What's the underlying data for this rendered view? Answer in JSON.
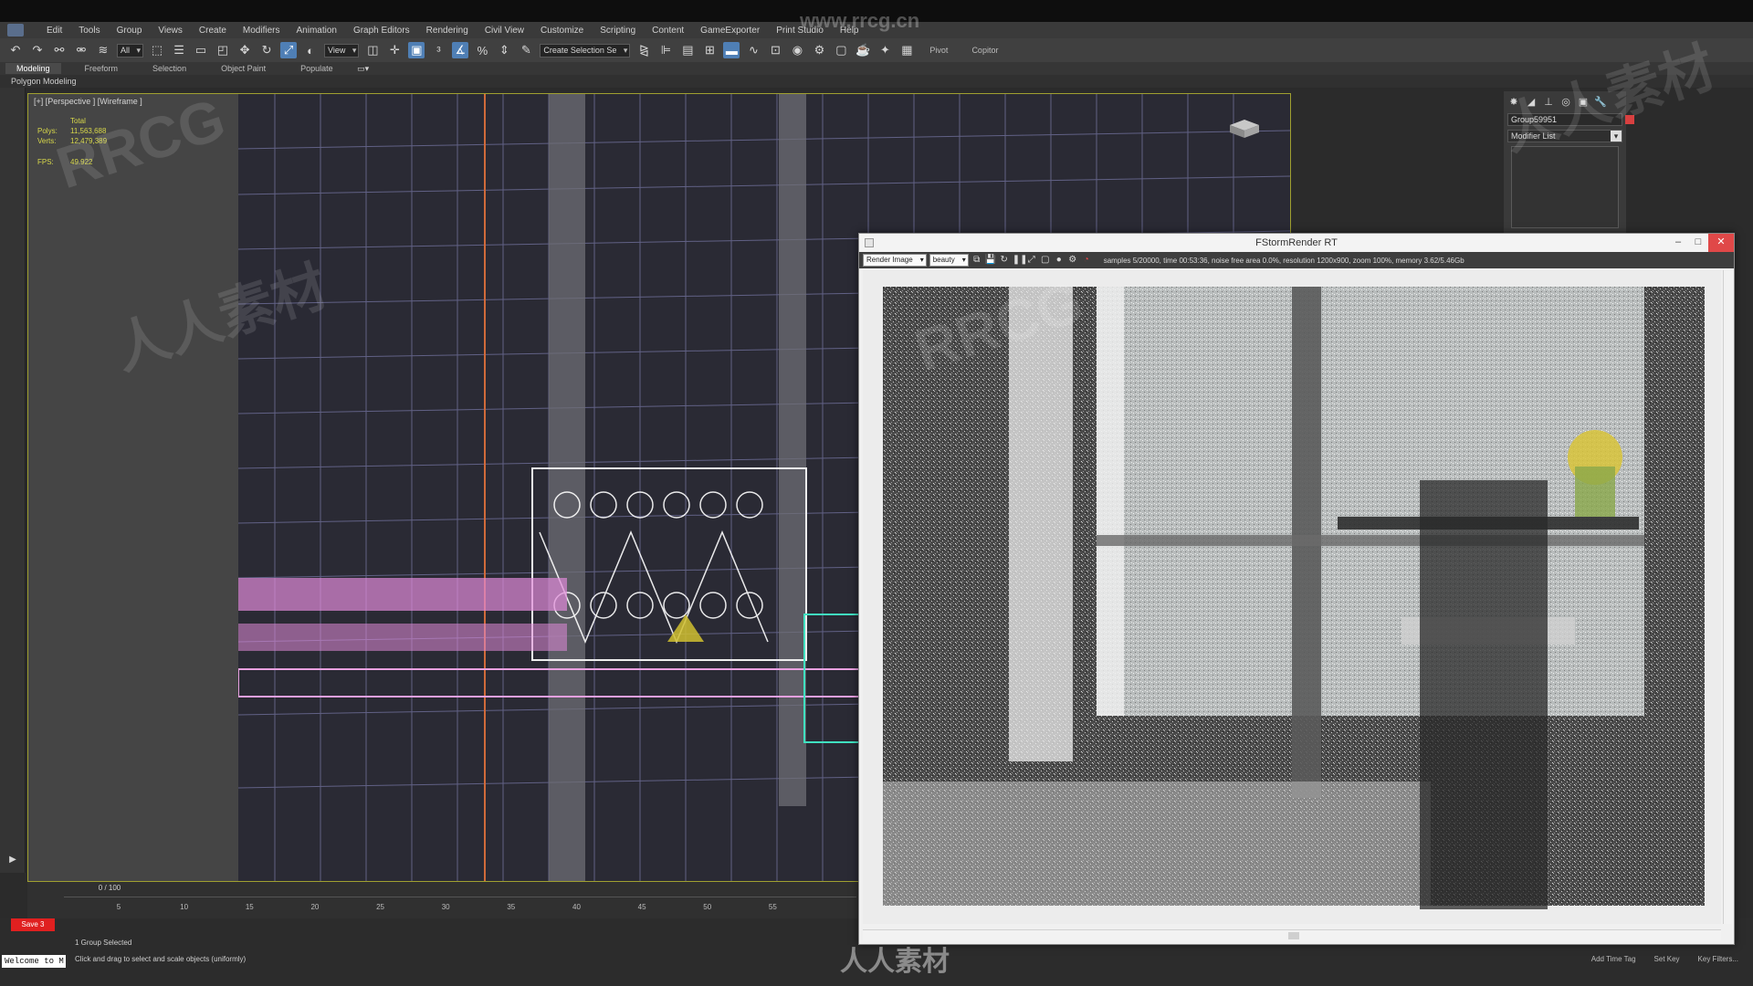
{
  "app": {
    "menu": [
      "Edit",
      "Tools",
      "Group",
      "Views",
      "Create",
      "Modifiers",
      "Animation",
      "Graph Editors",
      "Rendering",
      "Civil View",
      "Customize",
      "Scripting",
      "Content",
      "GameExporter",
      "Print Studio",
      "Help"
    ],
    "toolbar": {
      "selection_filter": "All",
      "ref_coord": "View",
      "named_selection": "Create Selection Se",
      "pivot_label": "Pivot",
      "copitor_label": "Copitor"
    },
    "ribbon": {
      "tabs": [
        "Modeling",
        "Freeform",
        "Selection",
        "Object Paint",
        "Populate"
      ],
      "active_tab": "Modeling",
      "panel_label": "Polygon Modeling"
    }
  },
  "viewport": {
    "label": "[+] [Perspective ] [Wireframe ]",
    "stats": {
      "total_label": "Total",
      "polys_label": "Polys:",
      "polys_value": "11,563,688",
      "verts_label": "Verts:",
      "verts_value": "12,479,389",
      "fps_label": "FPS:",
      "fps_value": "49.922"
    }
  },
  "command_panel": {
    "object_name": "Group59951",
    "modifier_list": "Modifier List",
    "object_color": "#d84040"
  },
  "timeline": {
    "frame_range": "0 / 100",
    "ticks": [
      "5",
      "10",
      "15",
      "20",
      "25",
      "30",
      "35",
      "40",
      "45",
      "50",
      "55"
    ]
  },
  "status": {
    "auto_key": "Save 3",
    "selection": "1 Group Selected",
    "prompt": "Click and drag to select and scale objects (uniformly)",
    "maxscript": "Welcome to M",
    "add_time_tag": "Add Time Tag",
    "set_key": "Set Key",
    "key_filters": "Key Filters..."
  },
  "render_window": {
    "title": "FStormRender RT",
    "mode_dropdown": "Render Image",
    "pass_dropdown": "beauty",
    "status": "samples 5/20000, time 00:53:36, noise free area 0.0%, resolution 1200x900, zoom 100%, memory 3.62/5.46Gb"
  },
  "watermark": {
    "site": "www.rrcg.cn",
    "brand": "RRCG",
    "cn_text": "人人素材"
  },
  "colors": {
    "viewport_border": "#a0a030",
    "stats_text": "#d8d84a",
    "auto_key_bg": "#e02020",
    "active_tool": "#4f7fb5"
  }
}
